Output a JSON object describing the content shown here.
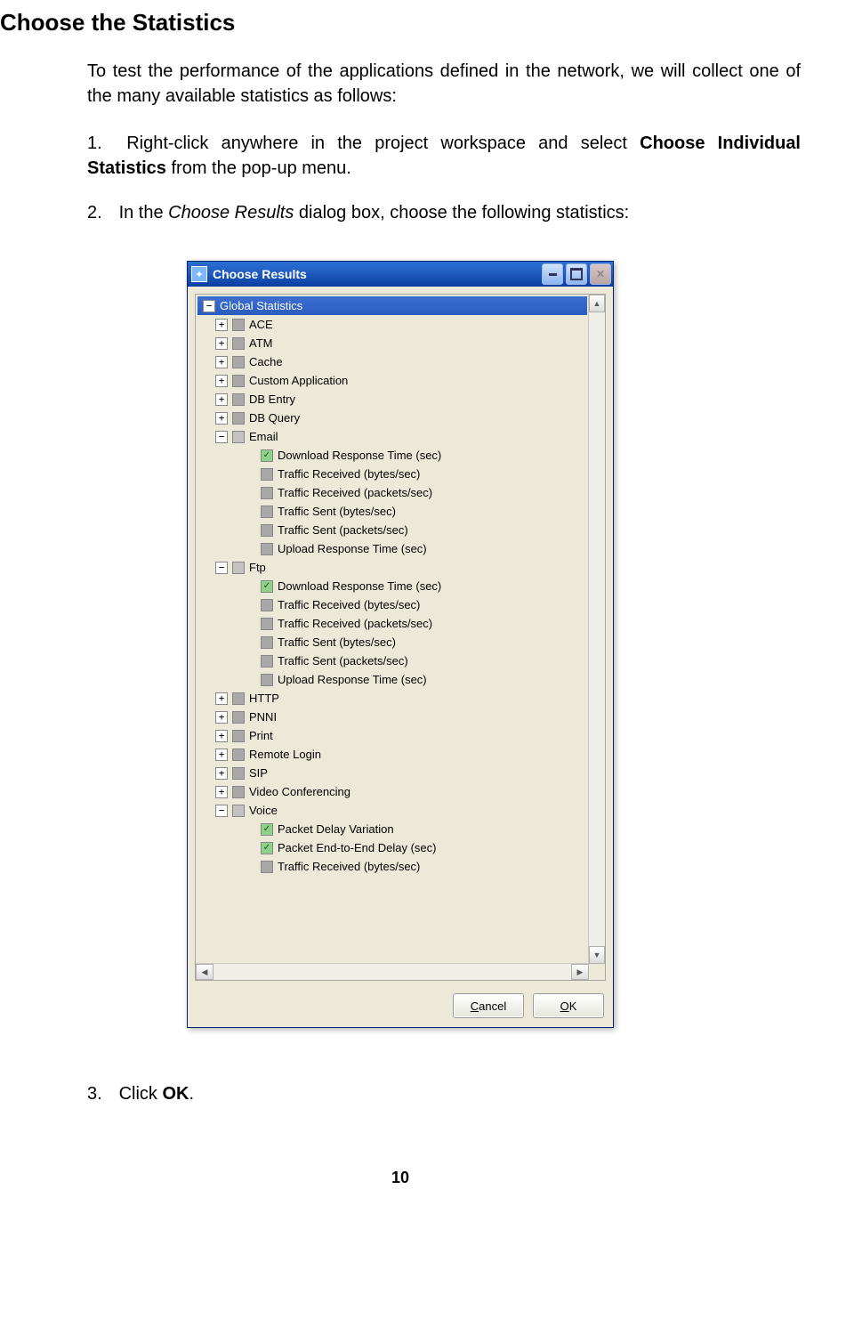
{
  "doc": {
    "heading": "Choose the Statistics",
    "intro": "To test the performance of the applications defined in the network, we will collect one of the many available statistics as follows:",
    "step1_a": "Right-click anywhere in the project workspace and select ",
    "step1_b": "Choose Individual Statistics",
    "step1_c": " from the pop-up menu.",
    "step2_a": "In the ",
    "step2_b": "Choose Results",
    "step2_c": " dialog box, choose the following statistics:",
    "step3_a": "Click ",
    "step3_b": "OK",
    "step3_c": ".",
    "pagenum": "10"
  },
  "dialog": {
    "title": "Choose Results",
    "root": "Global Statistics",
    "buttons": {
      "cancel": "Cancel",
      "ok": "OK"
    },
    "nodes": [
      {
        "level": 1,
        "pm": "+",
        "chk": "gray",
        "label": "ACE"
      },
      {
        "level": 1,
        "pm": "+",
        "chk": "gray",
        "label": "ATM"
      },
      {
        "level": 1,
        "pm": "+",
        "chk": "gray",
        "label": "Cache"
      },
      {
        "level": 1,
        "pm": "+",
        "chk": "gray",
        "label": "Custom Application"
      },
      {
        "level": 1,
        "pm": "+",
        "chk": "gray",
        "label": "DB Entry"
      },
      {
        "level": 1,
        "pm": "+",
        "chk": "gray",
        "label": "DB Query"
      },
      {
        "level": 1,
        "pm": "-",
        "chk": "partial",
        "label": "Email"
      },
      {
        "level": 2,
        "pm": "",
        "chk": "green",
        "label": "Download Response Time (sec)"
      },
      {
        "level": 2,
        "pm": "",
        "chk": "gray",
        "label": "Traffic Received (bytes/sec)"
      },
      {
        "level": 2,
        "pm": "",
        "chk": "gray",
        "label": "Traffic Received (packets/sec)"
      },
      {
        "level": 2,
        "pm": "",
        "chk": "gray",
        "label": "Traffic Sent (bytes/sec)"
      },
      {
        "level": 2,
        "pm": "",
        "chk": "gray",
        "label": "Traffic Sent (packets/sec)"
      },
      {
        "level": 2,
        "pm": "",
        "chk": "gray",
        "label": "Upload Response Time (sec)"
      },
      {
        "level": 1,
        "pm": "-",
        "chk": "partial",
        "label": "Ftp"
      },
      {
        "level": 2,
        "pm": "",
        "chk": "green",
        "label": "Download Response Time (sec)"
      },
      {
        "level": 2,
        "pm": "",
        "chk": "gray",
        "label": "Traffic Received (bytes/sec)"
      },
      {
        "level": 2,
        "pm": "",
        "chk": "gray",
        "label": "Traffic Received (packets/sec)"
      },
      {
        "level": 2,
        "pm": "",
        "chk": "gray",
        "label": "Traffic Sent (bytes/sec)"
      },
      {
        "level": 2,
        "pm": "",
        "chk": "gray",
        "label": "Traffic Sent (packets/sec)"
      },
      {
        "level": 2,
        "pm": "",
        "chk": "gray",
        "label": "Upload Response Time (sec)"
      },
      {
        "level": 1,
        "pm": "+",
        "chk": "gray",
        "label": "HTTP"
      },
      {
        "level": 1,
        "pm": "+",
        "chk": "gray",
        "label": "PNNI"
      },
      {
        "level": 1,
        "pm": "+",
        "chk": "gray",
        "label": "Print"
      },
      {
        "level": 1,
        "pm": "+",
        "chk": "gray",
        "label": "Remote Login"
      },
      {
        "level": 1,
        "pm": "+",
        "chk": "gray",
        "label": "SIP"
      },
      {
        "level": 1,
        "pm": "+",
        "chk": "gray",
        "label": "Video Conferencing"
      },
      {
        "level": 1,
        "pm": "-",
        "chk": "partial",
        "label": "Voice"
      },
      {
        "level": 2,
        "pm": "",
        "chk": "green",
        "label": "Packet Delay Variation"
      },
      {
        "level": 2,
        "pm": "",
        "chk": "green",
        "label": "Packet End-to-End Delay (sec)"
      },
      {
        "level": 2,
        "pm": "",
        "chk": "gray",
        "label": "Traffic Received (bytes/sec)"
      }
    ]
  }
}
